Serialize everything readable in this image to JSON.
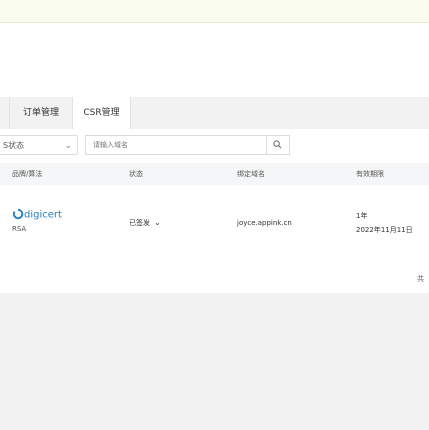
{
  "tabs": {
    "orders": "订单管理",
    "csr": "CSR管理"
  },
  "filters": {
    "status_value": "S状态",
    "search_placeholder": "请输入域名"
  },
  "table": {
    "headers": [
      "品牌/算法",
      "状态",
      "绑定域名",
      "有效期限"
    ],
    "rows": [
      {
        "brand": "digicert",
        "algorithm": "RSA",
        "status": "已签发",
        "domain": "joyce.appink.cn",
        "validity_years": "1年",
        "expiry_date": "2022年11月11日"
      }
    ]
  },
  "pagination": {
    "total_label": "共"
  },
  "colors": {
    "brand_blue": "#1e7fc6"
  },
  "icons": [
    "chevron-down-icon",
    "search-icon",
    "digicert-logo"
  ]
}
